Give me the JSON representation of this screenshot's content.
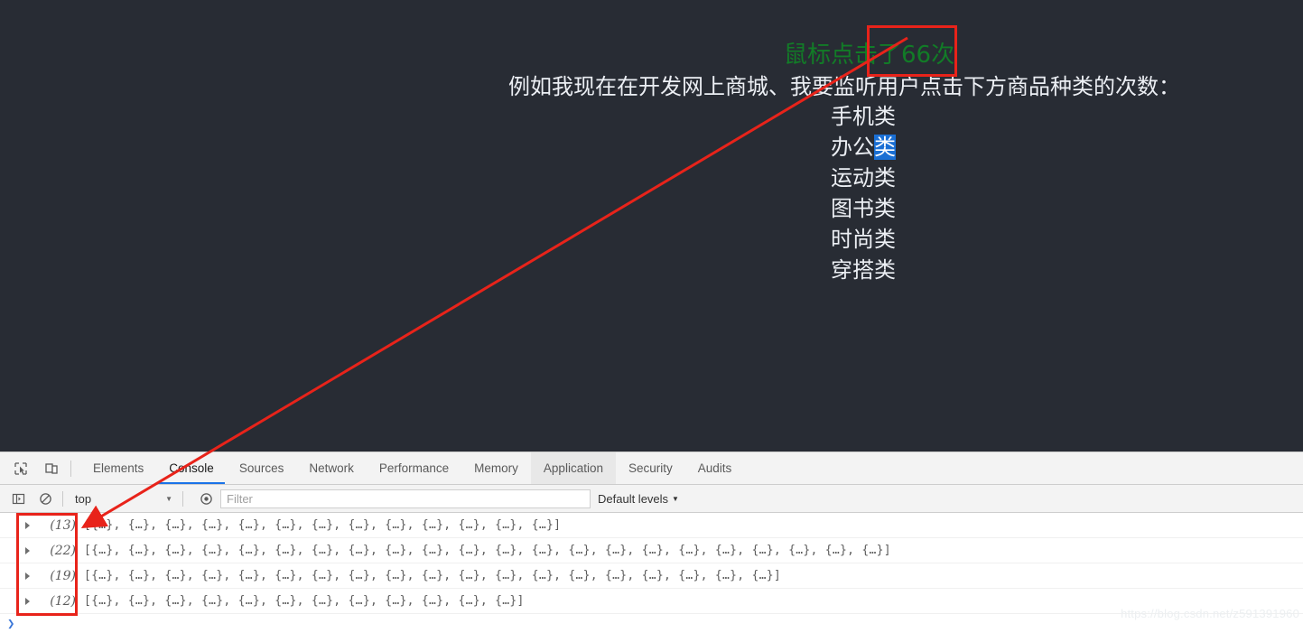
{
  "page": {
    "click_counter_text": "鼠标点击了66次",
    "heading": "例如我现在在开发网上商城、我要监听用户点击下方商品种类的次数：",
    "categories": [
      {
        "prefix": "手机",
        "suffix": "类",
        "selected": false
      },
      {
        "prefix": "办公",
        "suffix": "类",
        "selected": true
      },
      {
        "prefix": "运动",
        "suffix": "类",
        "selected": false
      },
      {
        "prefix": "图书",
        "suffix": "类",
        "selected": false
      },
      {
        "prefix": "时尚",
        "suffix": "类",
        "selected": false
      },
      {
        "prefix": "穿搭",
        "suffix": "类",
        "selected": false
      }
    ],
    "colors": {
      "background": "#282c34",
      "text": "#eceff4",
      "counter_green": "#127c27",
      "selection_blue": "#1a6fd4"
    }
  },
  "devtools": {
    "icons": {
      "inspect": "inspect-element-icon",
      "device": "device-toolbar-icon",
      "sidebar": "console-sidebar-icon",
      "clear": "clear-console-icon",
      "eye": "live-expression-icon"
    },
    "tabs": [
      {
        "label": "Elements",
        "state": "normal"
      },
      {
        "label": "Console",
        "state": "active"
      },
      {
        "label": "Sources",
        "state": "normal"
      },
      {
        "label": "Network",
        "state": "normal"
      },
      {
        "label": "Performance",
        "state": "normal"
      },
      {
        "label": "Memory",
        "state": "normal"
      },
      {
        "label": "Application",
        "state": "hovered"
      },
      {
        "label": "Security",
        "state": "normal"
      },
      {
        "label": "Audits",
        "state": "normal"
      }
    ],
    "console_toolbar": {
      "context": "top",
      "context_caret": "▼",
      "filter_placeholder": "Filter",
      "filter_value": "",
      "levels_label": "Default levels",
      "levels_caret": "▼"
    },
    "console_rows": [
      {
        "count": "(13)",
        "preview": "[{…}, {…}, {…}, {…}, {…}, {…}, {…}, {…}, {…}, {…}, {…}, {…}, {…}]"
      },
      {
        "count": "(22)",
        "preview": "[{…}, {…}, {…}, {…}, {…}, {…}, {…}, {…}, {…}, {…}, {…}, {…}, {…}, {…}, {…}, {…}, {…}, {…}, {…}, {…}, {…}, {…}]"
      },
      {
        "count": "(19)",
        "preview": "[{…}, {…}, {…}, {…}, {…}, {…}, {…}, {…}, {…}, {…}, {…}, {…}, {…}, {…}, {…}, {…}, {…}, {…}, {…}]"
      },
      {
        "count": "(12)",
        "preview": "[{…}, {…}, {…}, {…}, {…}, {…}, {…}, {…}, {…}, {…}, {…}, {…}]"
      }
    ],
    "prompt_symbol": "❯",
    "active_tab_underline_color": "#1a73e8"
  },
  "watermark": "https://blog.csdn.net/z591391960",
  "annotations": {
    "color": "#e8231a",
    "arrow_label": "red-pointer-arrow",
    "rect_top_label": "counter-highlight-box",
    "rect_bottom_label": "console-counts-highlight-box"
  }
}
